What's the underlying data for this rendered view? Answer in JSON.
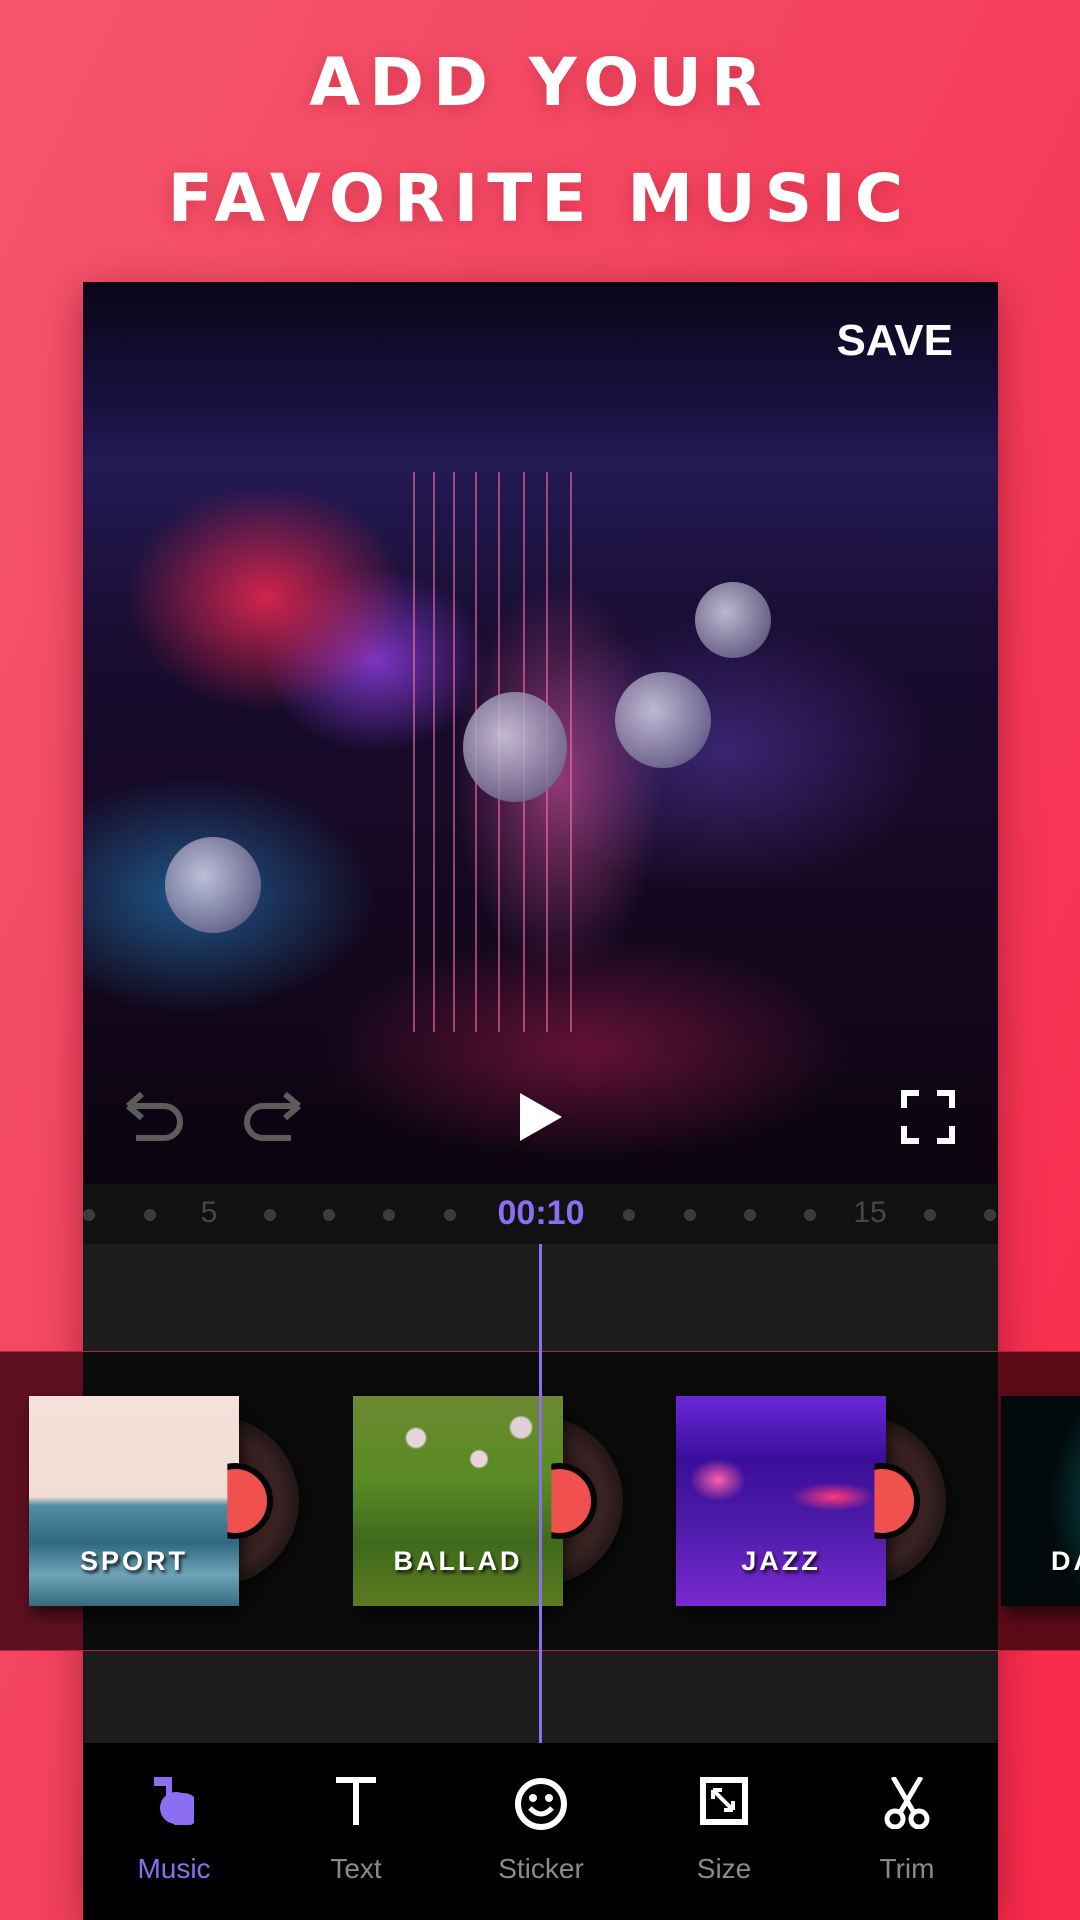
{
  "headline": {
    "line1": "ADD YOUR",
    "line2": "FAVORITE MUSIC"
  },
  "editor": {
    "save_label": "SAVE",
    "controls": {
      "undo_icon": "undo-icon",
      "redo_icon": "redo-icon",
      "play_icon": "play-icon",
      "fullscreen_icon": "fullscreen-icon"
    },
    "timeline": {
      "current_time": "00:10",
      "tick_labels": [
        "5",
        "15"
      ]
    }
  },
  "music_genres": [
    {
      "title": "SPORT"
    },
    {
      "title": "BALLAD"
    },
    {
      "title": "JAZZ"
    },
    {
      "title": "DA"
    }
  ],
  "bottom_nav": [
    {
      "label": "Music",
      "icon": "music-note-icon",
      "active": true
    },
    {
      "label": "Text",
      "icon": "text-icon",
      "active": false
    },
    {
      "label": "Sticker",
      "icon": "smiley-icon",
      "active": false
    },
    {
      "label": "Size",
      "icon": "resize-icon",
      "active": false
    },
    {
      "label": "Trim",
      "icon": "scissors-icon",
      "active": false
    }
  ],
  "colors": {
    "accent": "#8b6ff0",
    "background": "#f4435f",
    "record_label": "#f0504e"
  }
}
